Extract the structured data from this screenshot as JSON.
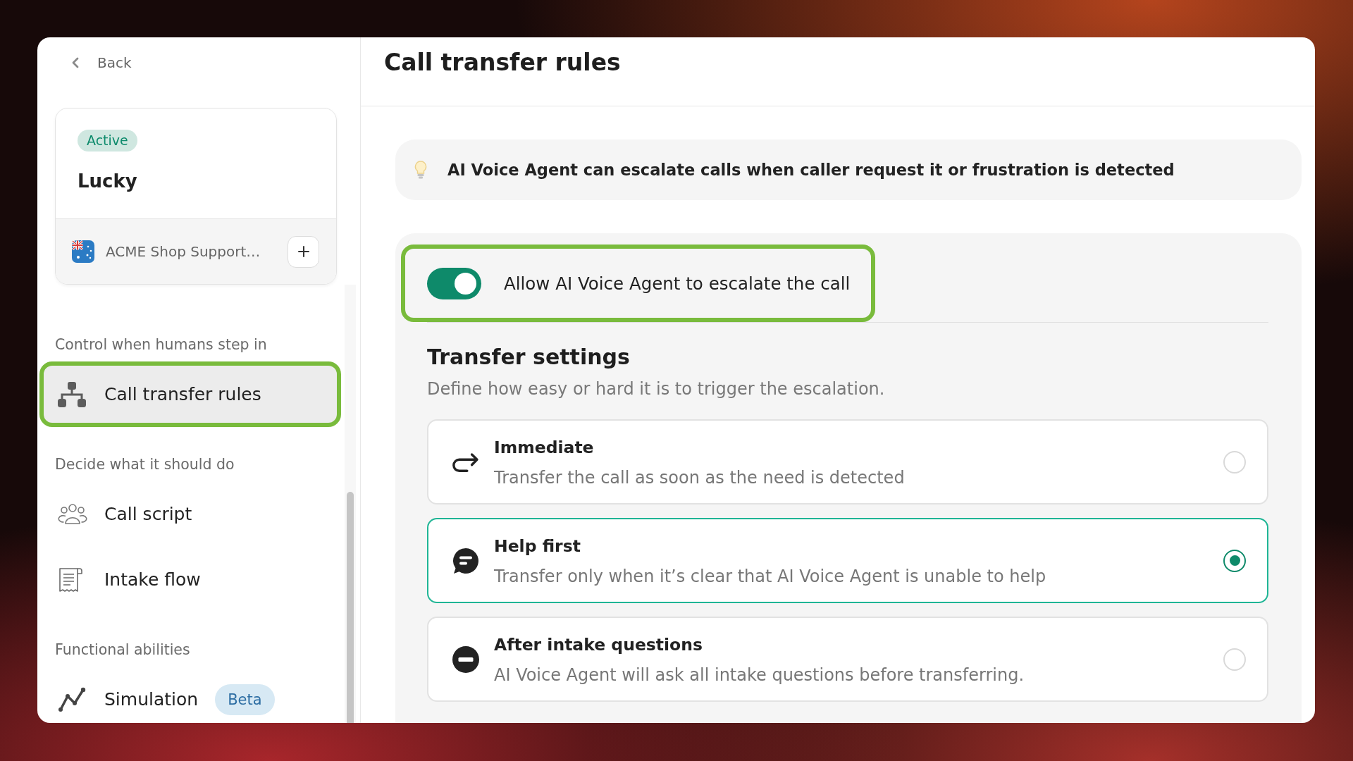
{
  "sidebar": {
    "back": "Back",
    "agent": {
      "status": "Active",
      "name": "Lucky",
      "line": "ACME Shop Support…"
    },
    "sections": [
      {
        "heading": "Control when humans step in",
        "items": [
          {
            "label": "Call transfer rules",
            "selected": true,
            "highlighted": true
          }
        ]
      },
      {
        "heading": "Decide what it should do",
        "items": [
          {
            "label": "Call script",
            "selected": false,
            "highlighted": false
          },
          {
            "label": "Intake flow",
            "selected": false,
            "highlighted": false
          }
        ]
      },
      {
        "heading": "Functional abilities",
        "items": [
          {
            "label": "Simulation",
            "selected": false,
            "highlighted": false,
            "badge": "Beta"
          }
        ]
      }
    ]
  },
  "page": {
    "title": "Call transfer rules",
    "tip": "AI Voice Agent can escalate calls when caller request it or frustration is detected",
    "escalation": {
      "label": "Allow AI Voice Agent to escalate the call",
      "on": true,
      "highlighted": true
    },
    "transfer_settings": {
      "title": "Transfer settings",
      "description": "Define how easy or hard it is to trigger the escalation.",
      "options": [
        {
          "title": "Immediate",
          "description": "Transfer the call as soon as the need is detected",
          "selected": false
        },
        {
          "title": "Help first",
          "description": "Transfer only when it’s clear that AI Voice Agent is unable to help",
          "selected": true
        },
        {
          "title": "After intake questions",
          "description": "AI Voice Agent will ask all intake questions before transferring.",
          "selected": false
        }
      ]
    }
  }
}
